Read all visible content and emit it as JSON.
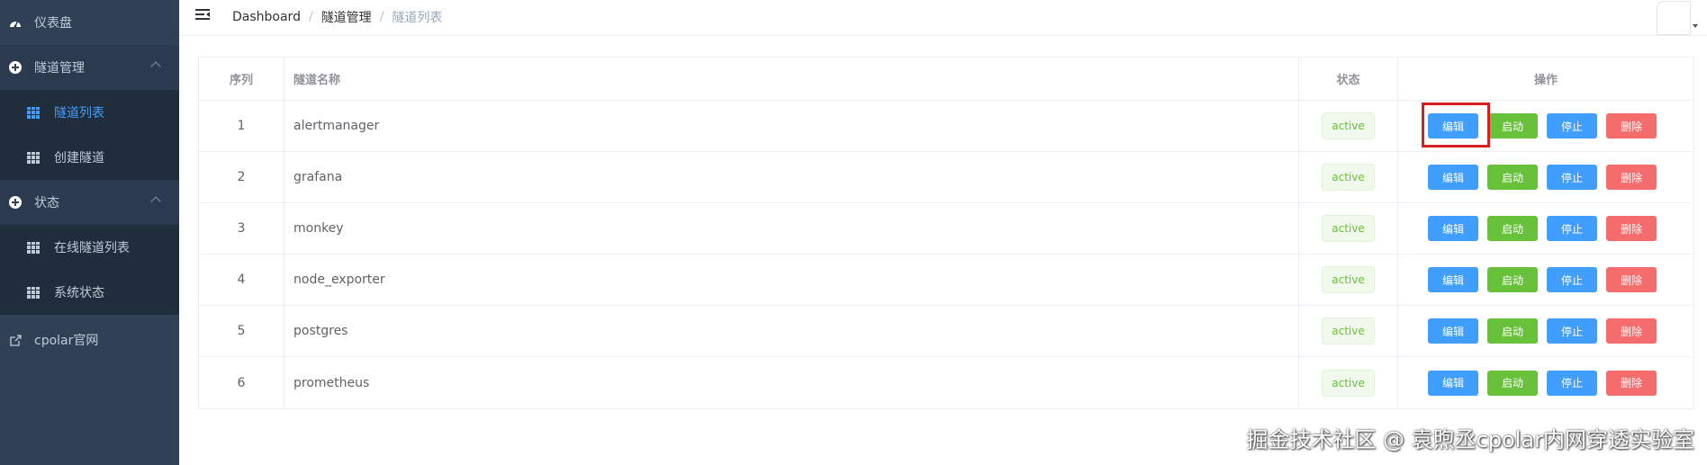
{
  "sidebar": {
    "dashboard": "仪表盘",
    "tunnel_mgmt": "隧道管理",
    "tunnel_list": "隧道列表",
    "create_tunnel": "创建隧道",
    "status": "状态",
    "online_tunnels": "在线隧道列表",
    "system_status": "系统状态",
    "cpolar_site": "cpolar官网"
  },
  "breadcrumb": {
    "home": "Dashboard",
    "section": "隧道管理",
    "current": "隧道列表",
    "separator": "/"
  },
  "table": {
    "headers": {
      "index": "序列",
      "name": "隧道名称",
      "status": "状态",
      "ops": "操作"
    },
    "rows": [
      {
        "index": "1",
        "name": "alertmanager",
        "status": "active"
      },
      {
        "index": "2",
        "name": "grafana",
        "status": "active"
      },
      {
        "index": "3",
        "name": "monkey",
        "status": "active"
      },
      {
        "index": "4",
        "name": "node_exporter",
        "status": "active"
      },
      {
        "index": "5",
        "name": "postgres",
        "status": "active"
      },
      {
        "index": "6",
        "name": "prometheus",
        "status": "active"
      }
    ],
    "buttons": {
      "edit": "编辑",
      "start": "启动",
      "stop": "停止",
      "delete": "删除"
    }
  },
  "watermark": "掘金技术社区 @ 袁煦丞cpolar内网穿透实验室",
  "colors": {
    "sidebar_bg": "#304156",
    "primary": "#409eff",
    "success": "#67c23a",
    "danger": "#f56c6c",
    "highlight": "#d81e1e"
  }
}
